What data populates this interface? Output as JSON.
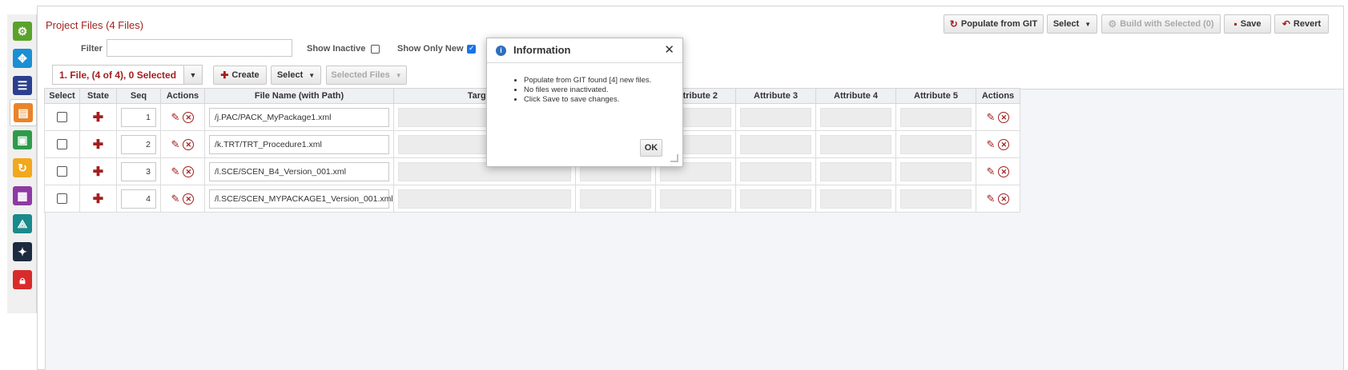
{
  "header": {
    "title": "Project Files (4 Files)",
    "populate_label": "Populate from GIT",
    "select_label": "Select",
    "build_label": "Build with Selected (0)",
    "save_label": "Save",
    "revert_label": "Revert"
  },
  "filters": {
    "filter_label": "Filter",
    "filter_value": "",
    "show_inactive_label": "Show Inactive",
    "show_inactive_checked": false,
    "show_only_new_label": "Show Only New",
    "show_only_new_checked": true
  },
  "toolbar": {
    "selection_summary": "1. File, (4 of 4), 0 Selected",
    "create_label": "Create",
    "select_label": "Select",
    "selected_files_label": "Selected Files"
  },
  "table": {
    "columns": [
      "Select",
      "State",
      "Seq",
      "Actions",
      "File Name (with Path)",
      "Target F",
      "",
      "Attribute 2",
      "Attribute 3",
      "Attribute 4",
      "Attribute 5",
      "Actions"
    ],
    "rows": [
      {
        "seq": "1",
        "file": "/j.PAC/PACK_MyPackage1.xml"
      },
      {
        "seq": "2",
        "file": "/k.TRT/TRT_Procedure1.xml"
      },
      {
        "seq": "3",
        "file": "/l.SCE/SCEN_B4_Version_001.xml"
      },
      {
        "seq": "4",
        "file": "/l.SCE/SCEN_MYPACKAGE1_Version_001.xml"
      }
    ]
  },
  "dialog": {
    "title": "Information",
    "messages": [
      "Populate from GIT found [4] new files.",
      "No files were inactivated.",
      "Click Save to save changes."
    ],
    "ok_label": "OK"
  },
  "colors": {
    "accent": "#a31f1f",
    "info": "#2e6fbc"
  },
  "nav": {
    "icons": [
      "deploy-icon",
      "components-icon",
      "list-icon",
      "project-files-icon",
      "package-icon",
      "refresh-icon",
      "report-icon",
      "network-icon",
      "tools-icon",
      "lock-icon"
    ]
  }
}
